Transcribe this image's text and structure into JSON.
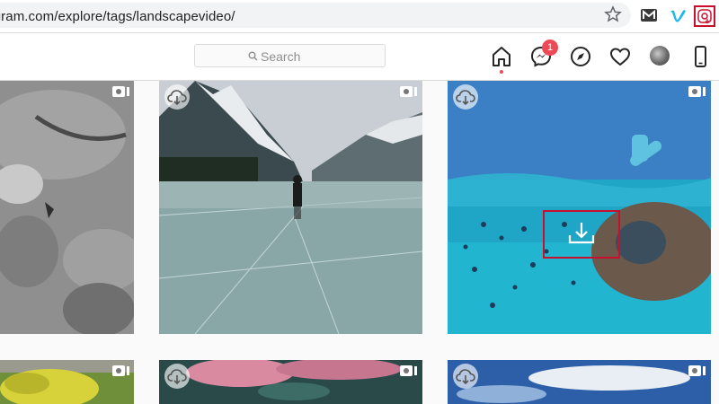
{
  "browser": {
    "url": "tagram.com/explore/tags/landscapevideo/",
    "bookmark_icon": "star-icon",
    "extensions": [
      "m-extension-icon",
      "vimeo-icon",
      "downloader-extension-icon"
    ]
  },
  "header": {
    "search_placeholder": "Search",
    "messenger_badge": "1",
    "nav_icons": [
      "home-icon",
      "messenger-icon",
      "explore-compass-icon",
      "heart-icon",
      "avatar",
      "mobile-icon"
    ]
  },
  "grid": {
    "tiles": [
      {
        "name": "tile-statue",
        "scene": "stone statue face"
      },
      {
        "name": "tile-frozen-lake",
        "scene": "person standing on frozen mountain lake"
      },
      {
        "name": "tile-underwater",
        "scene": "underwater snorkeling with fish"
      },
      {
        "name": "tile-garden",
        "scene": "yellow garden hedge"
      },
      {
        "name": "tile-pink-flowers",
        "scene": "pink flowers"
      },
      {
        "name": "tile-blue-sky",
        "scene": "blue sky with clouds"
      }
    ]
  },
  "colors": {
    "badge": "#ed4956",
    "highlight": "#c8102e",
    "underwater": "#1fa6c7"
  }
}
